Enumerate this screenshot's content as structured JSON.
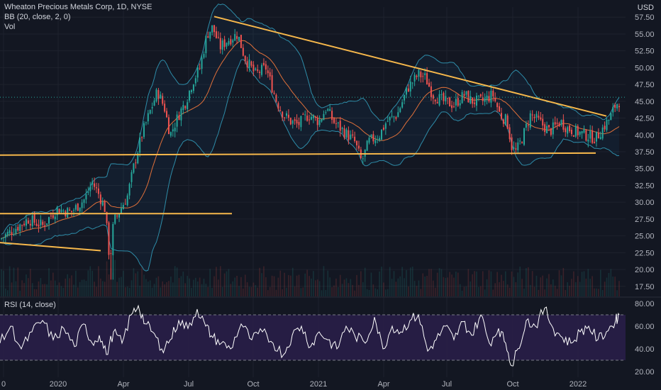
{
  "header": {
    "symbol_line": "Wheaton Precious Metals Corp, 1D, NYSE",
    "indicator_bb": "BB (20, close, 2, 0)",
    "indicator_vol": "Vol",
    "currency": "USD"
  },
  "rsi": {
    "title": "RSI (14, close)"
  },
  "colors": {
    "background": "#131722",
    "up": "#26a69a",
    "down": "#ef5350",
    "bb_band": "#2e8ca8",
    "bb_basis": "#e0703a",
    "trendline": "#f7b84b",
    "rsi_line": "#ffffff",
    "rsi_fill": "#2a1f4a"
  },
  "chart_data": [
    {
      "type": "candlestick",
      "ylim": [
        16,
        59
      ],
      "y_ticks": [
        "57.50",
        "55.00",
        "52.50",
        "50.00",
        "47.50",
        "45.00",
        "42.50",
        "40.00",
        "37.50",
        "35.00",
        "32.50",
        "30.00",
        "27.50",
        "25.00",
        "22.50",
        "20.00",
        "17.50"
      ],
      "x_ticks": [
        "0",
        "2020",
        "Apr",
        "Jul",
        "Oct",
        "2021",
        "Apr",
        "Jul",
        "Oct",
        "2022"
      ],
      "price_path": [
        [
          0,
          24.5
        ],
        [
          20,
          26
        ],
        [
          40,
          27.5
        ],
        [
          60,
          26.5
        ],
        [
          80,
          29
        ],
        [
          100,
          28.5
        ],
        [
          120,
          30.5
        ],
        [
          130,
          33
        ],
        [
          140,
          31
        ],
        [
          148,
          29
        ],
        [
          155,
          21
        ],
        [
          160,
          27
        ],
        [
          170,
          29
        ],
        [
          180,
          31
        ],
        [
          190,
          36
        ],
        [
          200,
          40
        ],
        [
          210,
          43
        ],
        [
          222,
          46.5
        ],
        [
          232,
          44
        ],
        [
          240,
          40
        ],
        [
          252,
          43
        ],
        [
          262,
          45
        ],
        [
          272,
          48
        ],
        [
          282,
          50
        ],
        [
          292,
          55
        ],
        [
          300,
          56
        ],
        [
          310,
          53
        ],
        [
          320,
          54
        ],
        [
          335,
          55
        ],
        [
          345,
          51.5
        ],
        [
          360,
          49
        ],
        [
          375,
          50
        ],
        [
          390,
          45
        ],
        [
          400,
          43
        ],
        [
          410,
          42
        ],
        [
          420,
          41.5
        ],
        [
          435,
          43
        ],
        [
          450,
          42
        ],
        [
          460,
          44
        ],
        [
          470,
          42
        ],
        [
          480,
          41
        ],
        [
          490,
          40
        ],
        [
          500,
          39
        ],
        [
          510,
          36
        ],
        [
          520,
          39
        ],
        [
          535,
          40
        ],
        [
          545,
          42
        ],
        [
          560,
          43
        ],
        [
          575,
          47
        ],
        [
          590,
          49
        ],
        [
          600,
          48.5
        ],
        [
          610,
          46
        ],
        [
          625,
          45
        ],
        [
          640,
          44.5
        ],
        [
          655,
          46
        ],
        [
          665,
          45
        ],
        [
          680,
          45
        ],
        [
          695,
          46
        ],
        [
          705,
          43
        ],
        [
          715,
          42
        ],
        [
          722,
          38
        ],
        [
          728,
          37.5
        ],
        [
          738,
          40
        ],
        [
          748,
          43
        ],
        [
          760,
          42
        ],
        [
          775,
          40.5
        ],
        [
          790,
          42
        ],
        [
          800,
          41
        ],
        [
          812,
          40.5
        ],
        [
          825,
          40
        ],
        [
          840,
          39.5
        ],
        [
          850,
          41
        ],
        [
          860,
          42.5
        ],
        [
          868,
          44.5
        ],
        [
          873,
          45
        ]
      ],
      "last_price": 45.6,
      "trendlines": [
        {
          "from": [
            0,
            24
          ],
          "to": [
            142,
            22.8
          ]
        },
        {
          "from": [
            0,
            28.3
          ],
          "to": [
            327,
            28.3
          ]
        },
        {
          "from": [
            0,
            37
          ],
          "to": [
            840,
            37.3
          ]
        },
        {
          "from": [
            302,
            57.6
          ],
          "to": [
            855,
            42.8
          ]
        }
      ]
    },
    {
      "type": "line",
      "name": "RSI (14, close)",
      "ylim": [
        15,
        85
      ],
      "y_ticks": [
        "80.00",
        "60.00",
        "40.00",
        "20.00"
      ],
      "bands": [
        70,
        30
      ],
      "x": [
        0,
        15,
        30,
        45,
        60,
        75,
        90,
        105,
        118,
        130,
        140,
        150,
        160,
        172,
        185,
        195,
        205,
        215,
        228,
        240,
        252,
        265,
        278,
        290,
        300,
        312,
        325,
        340,
        355,
        370,
        385,
        400,
        412,
        425,
        438,
        450,
        462,
        475,
        488,
        500,
        515,
        528,
        540,
        553,
        565,
        578,
        590,
        603,
        615,
        628,
        640,
        653,
        665,
        678,
        690,
        703,
        713,
        722,
        730,
        742,
        755,
        768,
        780,
        793,
        805,
        818,
        830,
        843,
        855,
        868,
        873
      ],
      "values": [
        45,
        60,
        40,
        55,
        65,
        48,
        58,
        42,
        62,
        45,
        52,
        35,
        55,
        45,
        70,
        78,
        62,
        55,
        40,
        48,
        65,
        58,
        75,
        60,
        50,
        45,
        40,
        62,
        48,
        55,
        45,
        35,
        52,
        60,
        42,
        55,
        48,
        40,
        60,
        52,
        45,
        68,
        40,
        60,
        55,
        65,
        70,
        38,
        48,
        60,
        48,
        64,
        52,
        70,
        45,
        58,
        45,
        25,
        40,
        65,
        60,
        76,
        58,
        50,
        45,
        55,
        60,
        48,
        55,
        65,
        70
      ]
    }
  ]
}
